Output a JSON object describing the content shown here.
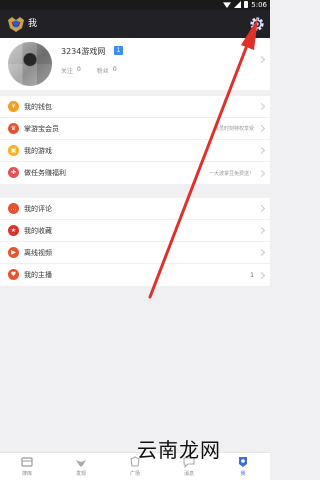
{
  "status_bar": {
    "time": "5:06"
  },
  "app_bar": {
    "title": "我"
  },
  "profile": {
    "name": "3234游戏网",
    "badge": "1",
    "follow_label": "关注",
    "follow_count": "0",
    "fans_label": "粉丝",
    "fans_count": "0"
  },
  "menu_group1": [
    {
      "label": "我的钱包",
      "icon": "wallet-icon",
      "color": "#f0a020"
    },
    {
      "label": "掌游宝会员",
      "icon": "crown-icon",
      "color": "#e6542e",
      "hint": "会员时刻特权享受"
    },
    {
      "label": "我的游戏",
      "icon": "game-icon",
      "color": "#f5b321"
    },
    {
      "label": "做任务赚福利",
      "icon": "gift-icon",
      "color": "#e65050",
      "hint": "一大波掌豆免费送！"
    }
  ],
  "menu_group2": [
    {
      "label": "我的评论",
      "icon": "comment-icon",
      "color": "#e6542e"
    },
    {
      "label": "我的收藏",
      "icon": "star-icon",
      "color": "#d9342b"
    },
    {
      "label": "离线视频",
      "icon": "play-icon",
      "color": "#e6542e"
    },
    {
      "label": "我的主播",
      "icon": "anchor-icon",
      "color": "#e6542e",
      "count": "1"
    }
  ],
  "tabs": [
    {
      "label": "搜库",
      "icon": "library-icon"
    },
    {
      "label": "发现",
      "icon": "eagle-icon"
    },
    {
      "label": "广场",
      "icon": "square-icon"
    },
    {
      "label": "消息",
      "icon": "message-icon"
    },
    {
      "label": "我",
      "icon": "me-icon",
      "active": true
    }
  ],
  "watermark": "云南龙网",
  "colors": {
    "appbar": "#222226",
    "arrow": "#e0302a",
    "accent": "#3a6fd8"
  }
}
